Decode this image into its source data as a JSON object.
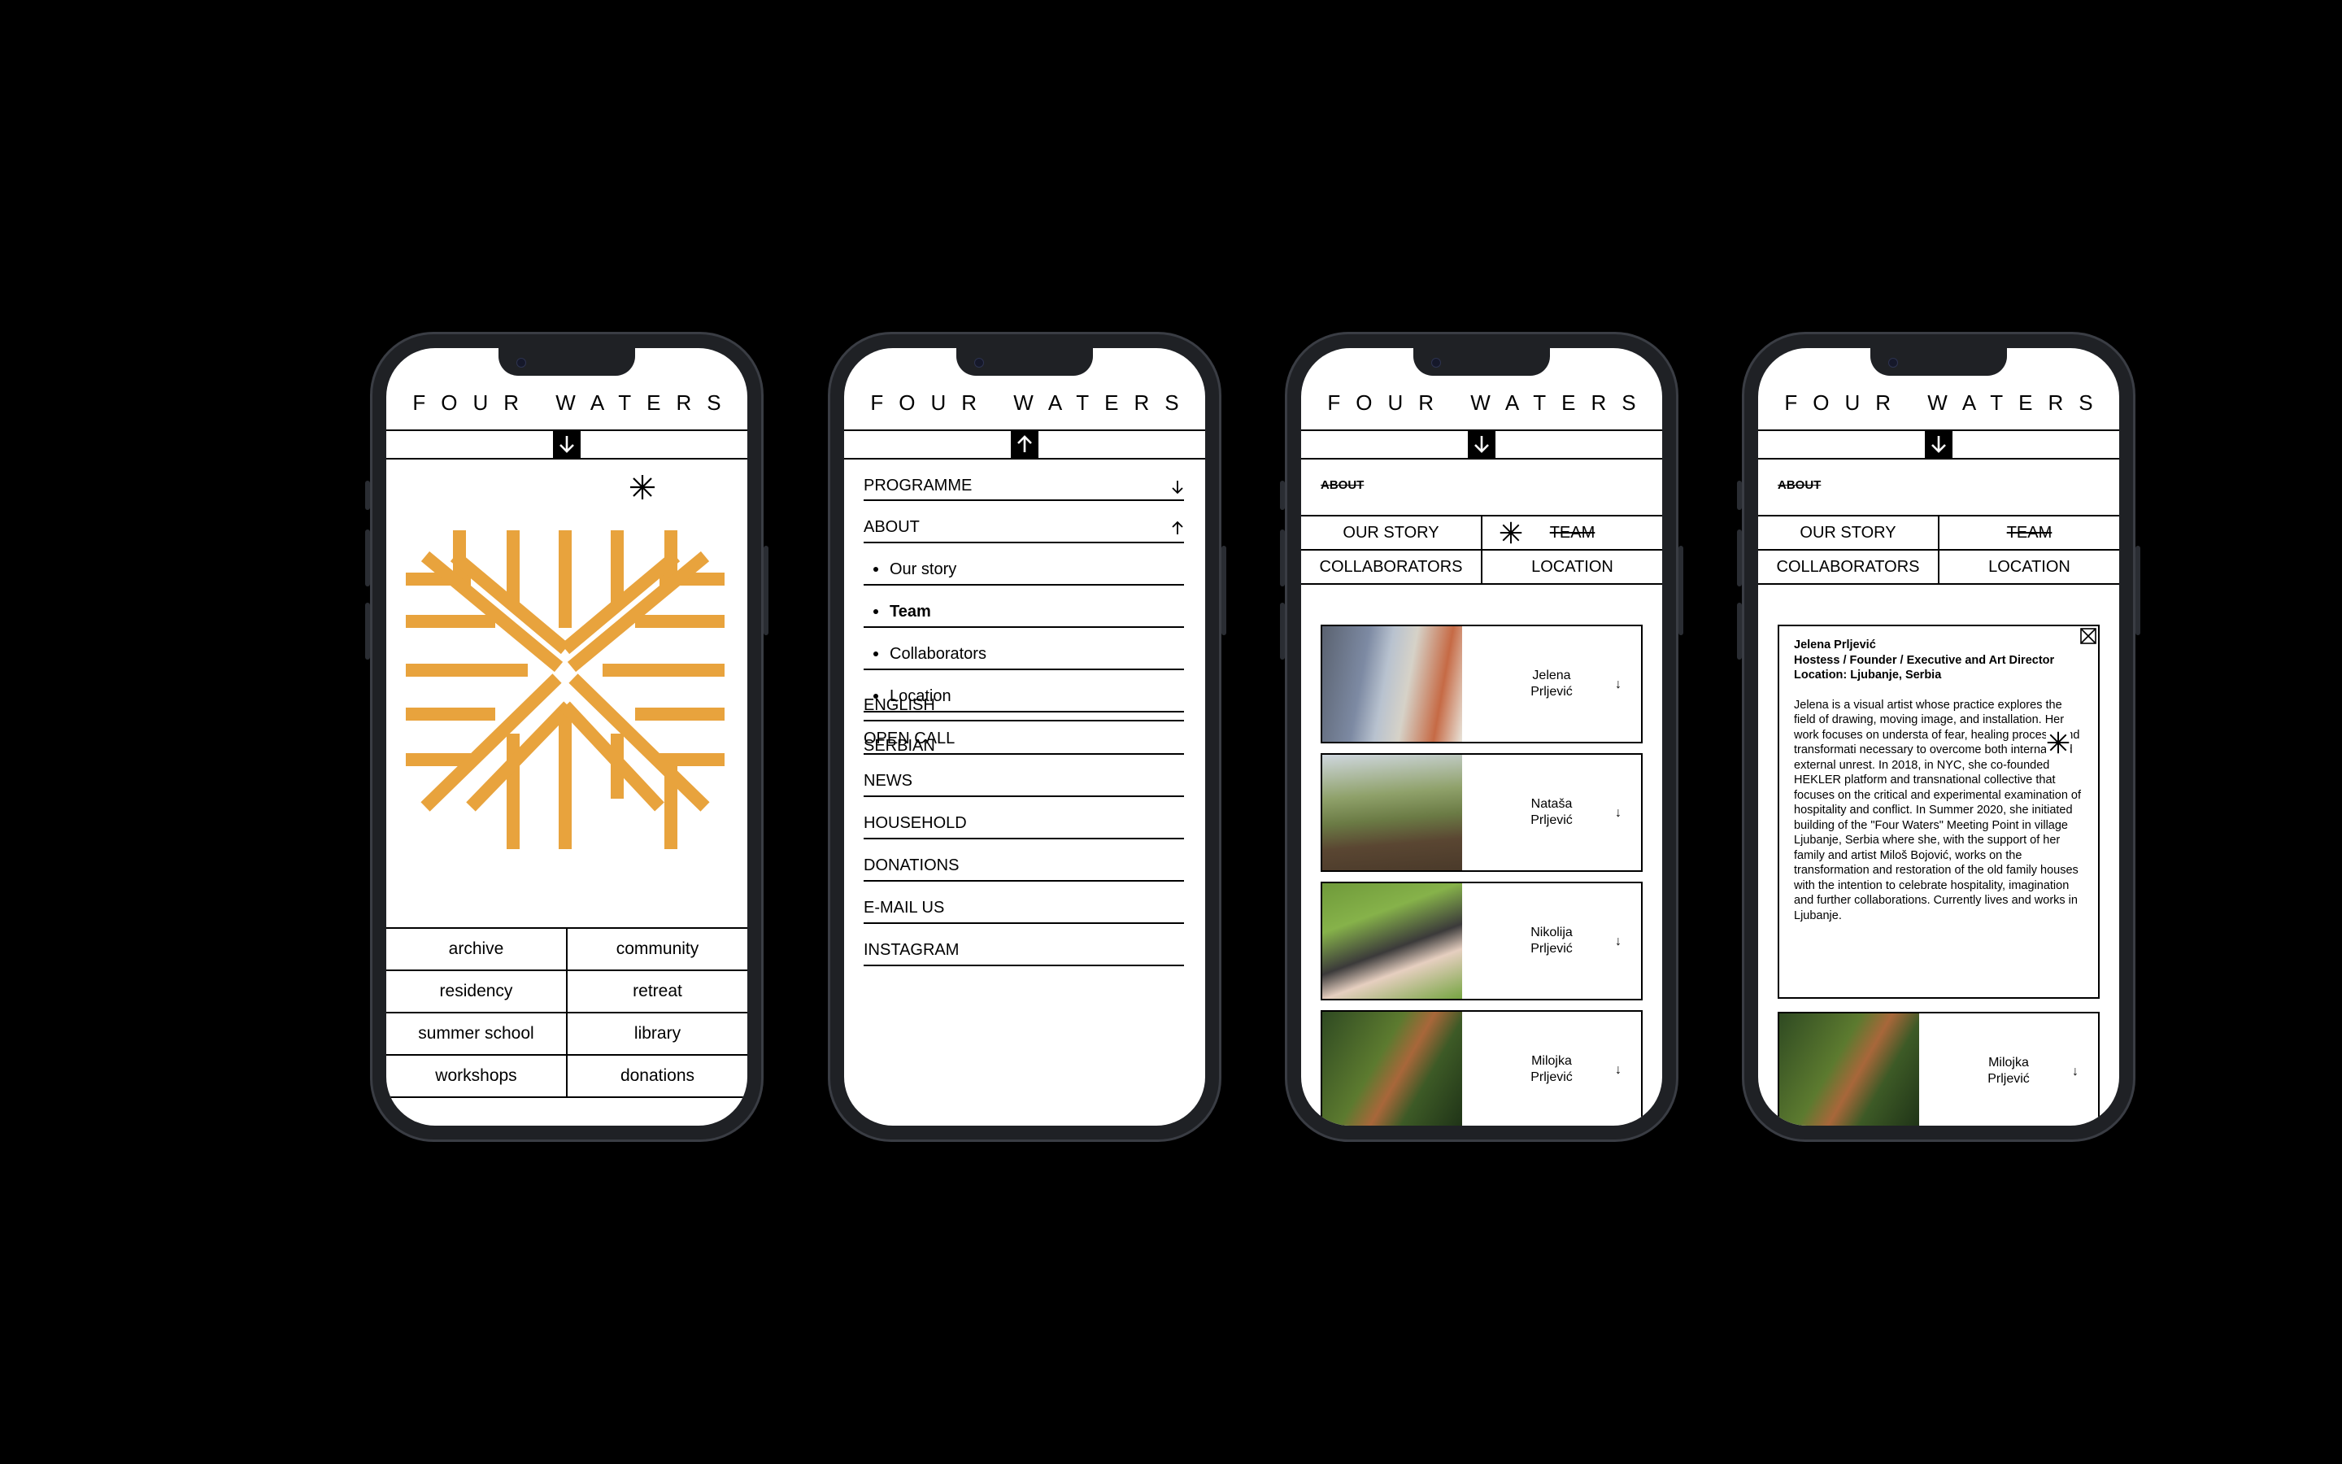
{
  "brand": "FOUR WATERS",
  "home": {
    "menu": [
      [
        "archive",
        "community"
      ],
      [
        "residency",
        "retreat"
      ],
      [
        "summer school",
        "library"
      ],
      [
        "workshops",
        "donations"
      ]
    ],
    "logo_color": "#E8A33D"
  },
  "nav": {
    "items": [
      {
        "label": "PROGRAMME",
        "arrow": "down"
      },
      {
        "label": "ABOUT",
        "arrow": "up"
      },
      {
        "label": "Our story",
        "sub": true
      },
      {
        "label": "Team",
        "sub": true,
        "bold": true
      },
      {
        "label": "Collaborators",
        "sub": true
      },
      {
        "label": "Location",
        "sub": true
      },
      {
        "label": "OPEN CALL"
      },
      {
        "label": "NEWS"
      },
      {
        "label": "HOUSEHOLD"
      },
      {
        "label": "DONATIONS"
      },
      {
        "label": "E-MAIL US"
      },
      {
        "label": "INSTAGRAM"
      }
    ],
    "languages": [
      "ENGLISH",
      "SERBIAN"
    ]
  },
  "about": {
    "label": "ABOUT",
    "tabs": [
      [
        "OUR STORY",
        "TEAM"
      ],
      [
        "COLLABORATORS",
        "LOCATION"
      ]
    ],
    "team": [
      {
        "first": "Jelena",
        "last": "Prljević"
      },
      {
        "first": "Nataša",
        "last": "Prljević"
      },
      {
        "first": "Nikolija",
        "last": "Prljević"
      },
      {
        "first": "Milojka",
        "last": "Prljević"
      }
    ]
  },
  "bio": {
    "name": "Jelena Prljević",
    "role": "Hostess / Founder / Executive and Art Director",
    "location": "Location: Ljubanje, Serbia",
    "text": "Jelena is a visual artist whose practice explores the field of drawing, moving image, and installation. Her work focuses on understa of fear, healing process, and transformati necessary to overcome both internal and external unrest. In 2018, in NYC, she co-founded HEKLER platform and transnational collective that focuses on the critical and experimental examination of hospitality and conflict. In Summer 2020, she initiated building of the \"Four Waters\" Meeting Point in village Ljubanje, Serbia where she, with the support of her family and artist Miloš Bojović, works on the transformation and restoration of the old family houses with the intention to celebrate hospitality, imagination and further collaborations. Currently lives and works in Ljubanje."
  }
}
